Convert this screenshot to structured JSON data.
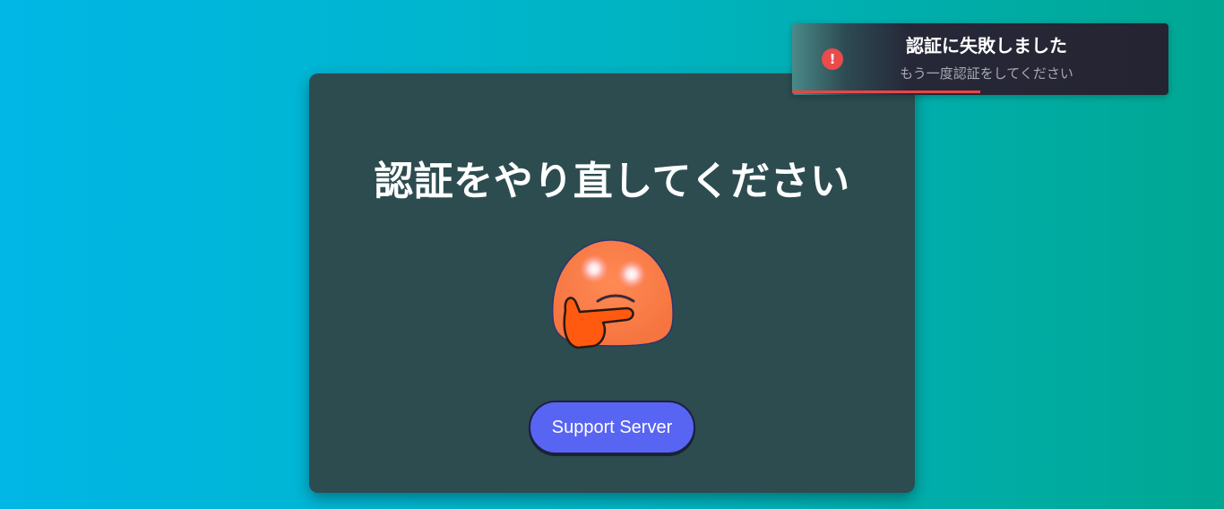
{
  "card": {
    "title": "認証をやり直してください",
    "emoji_name": "thinking-blob-emoji",
    "support_button_label": "Support Server"
  },
  "toast": {
    "title": "認証に失敗しました",
    "subtitle": "もう一度認証をしてください",
    "icon": "exclamation-icon",
    "icon_glyph": "!",
    "progress_fraction": 0.5,
    "accent_color": "#e84646"
  },
  "colors": {
    "background_start": "#00b7e6",
    "background_end": "#00a792",
    "card_bg": "#2c4c50",
    "button_bg": "#5865f2"
  }
}
